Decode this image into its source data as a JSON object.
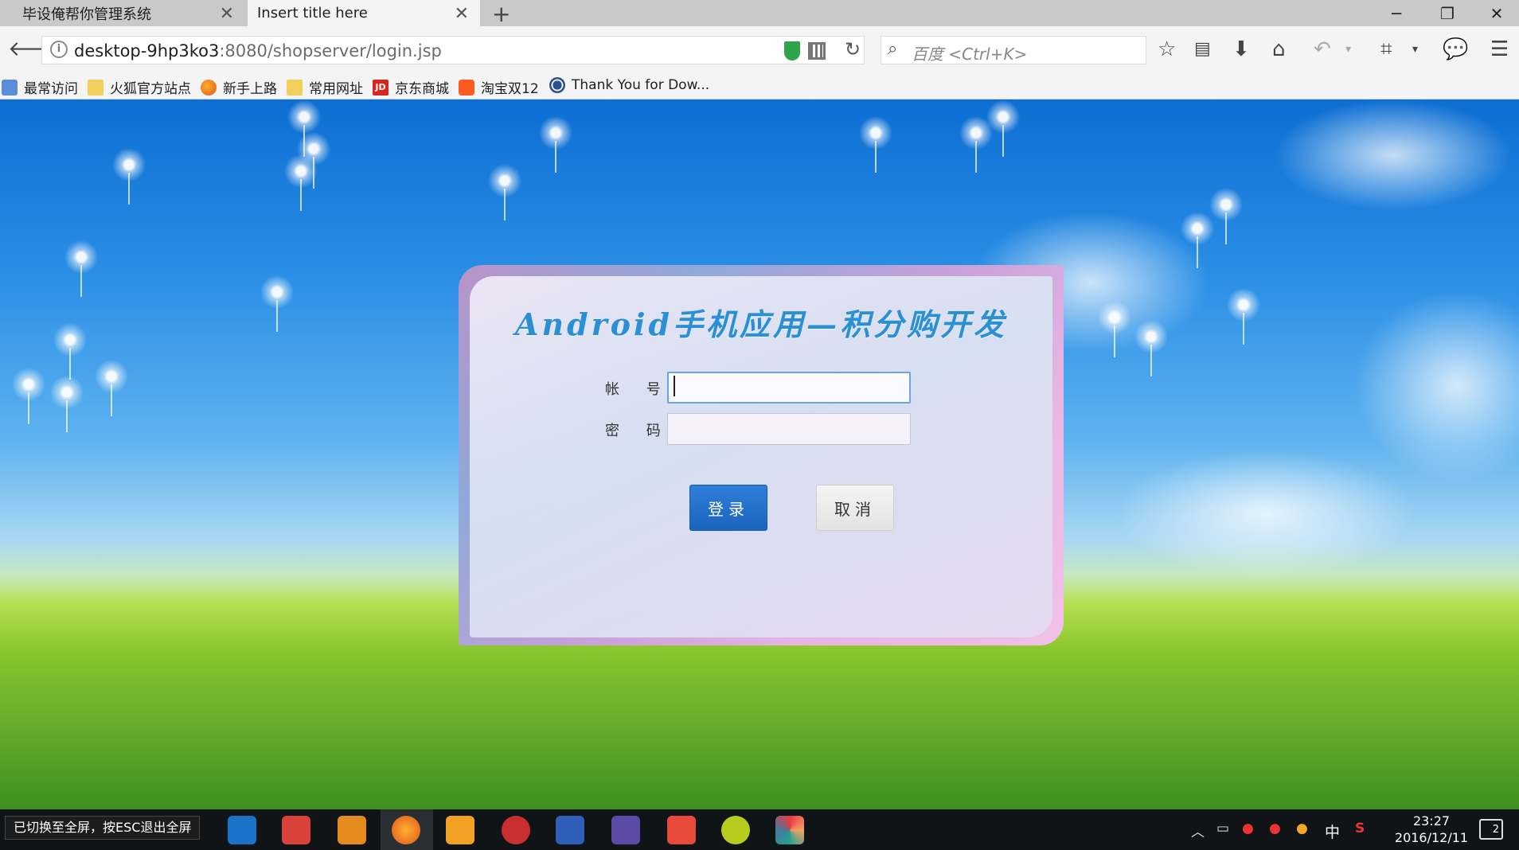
{
  "tabs": [
    {
      "label": "毕设俺帮你管理系统",
      "active": false
    },
    {
      "label": "Insert title here",
      "active": true
    }
  ],
  "window_controls": {
    "minimize": "─",
    "restore": "❐",
    "close": "✕"
  },
  "address_bar": {
    "host": "desktop-9hp3ko3",
    "path": ":8080/shopserver/login.jsp"
  },
  "search": {
    "placeholder": "百度 <Ctrl+K>"
  },
  "bookmarks": [
    {
      "label": "最常访问",
      "icon": "bookmark-blue-icon"
    },
    {
      "label": "火狐官方站点",
      "icon": "folder-icon"
    },
    {
      "label": "新手上路",
      "icon": "firefox-icon"
    },
    {
      "label": "常用网址",
      "icon": "folder-icon"
    },
    {
      "label": "京东商城",
      "icon": "jd-icon"
    },
    {
      "label": "淘宝双12",
      "icon": "taobao-icon"
    },
    {
      "label": "Thank You for Dow...",
      "icon": "globe-icon"
    }
  ],
  "login": {
    "title": "Android手机应用—积分购开发",
    "account_label": "帐 号:",
    "account_value": "",
    "password_label": "密 码:",
    "password_value": "",
    "login_button": "登录",
    "cancel_button": "取消"
  },
  "taskbar": {
    "toast": "已切换至全屏，按ESC退出全屏",
    "tray_ime": "中",
    "time": "23:27",
    "date": "2016/12/11",
    "notification_count": "2"
  },
  "colors": {
    "title_blue": "#2b8fd4",
    "login_button": "#1f6cc7",
    "sky_top": "#0d6ed2",
    "grass": "#86c52c"
  }
}
